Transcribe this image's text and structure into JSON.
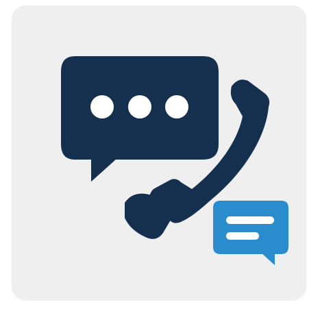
{
  "app_icon": {
    "icon_name": "chat-phone-icon",
    "parts": [
      "speech-bubble-icon",
      "telephone-handset-icon",
      "message-bubble-icon"
    ],
    "colors": {
      "tile_background": "#efeff0",
      "navy": "#15304f",
      "blue": "#2a8ccd",
      "white": "#ffffff"
    }
  }
}
